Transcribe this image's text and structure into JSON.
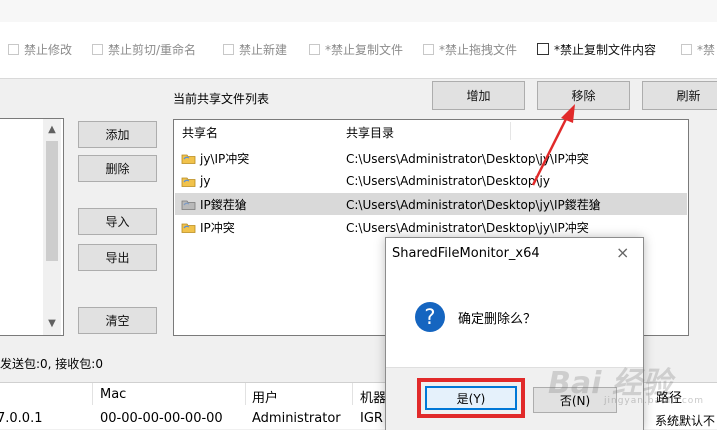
{
  "options": [
    {
      "label": "禁止修改",
      "checked": false,
      "strong": false
    },
    {
      "label": "禁止剪切/重命名",
      "checked": false,
      "strong": false
    },
    {
      "label": "禁止新建",
      "checked": false,
      "strong": false
    },
    {
      "label": "*禁止复制文件",
      "checked": false,
      "strong": false
    },
    {
      "label": "*禁止拖拽文件",
      "checked": false,
      "strong": false
    },
    {
      "label": "*禁止复制文件内容",
      "checked": false,
      "strong": true
    },
    {
      "label": "*禁",
      "checked": false,
      "strong": false
    }
  ],
  "share_list": {
    "label": "当前共享文件列表",
    "buttons": {
      "add": "增加",
      "remove": "移除",
      "refresh": "刷新"
    },
    "columns": [
      "共享名",
      "共享目录"
    ],
    "rows": [
      {
        "name": "jy\\IP冲突",
        "path": "C:\\Users\\Administrator\\Desktop\\jy\\IP冲突",
        "selected": false
      },
      {
        "name": "jy",
        "path": "C:\\Users\\Administrator\\Desktop\\jy",
        "selected": false
      },
      {
        "name": "IP鍐茬獊",
        "path": "C:\\Users\\Administrator\\Desktop\\jy\\IP鍐茬獊",
        "selected": true
      },
      {
        "name": "IP冲突",
        "path": "C:\\Users\\Administrator\\Desktop\\jy\\IP冲突",
        "selected": false
      }
    ]
  },
  "side_buttons": {
    "add": "添加",
    "delete": "删除",
    "import": "导入",
    "export": "导出",
    "clear": "清空"
  },
  "status": "发送包:0, 接收包:0",
  "bottom_table": {
    "headers": [
      "Mac",
      "用户",
      "机器",
      "路径"
    ],
    "row": {
      "ip": "7.0.0.1",
      "mac": "00-00-00-00-00-00",
      "user": "Administrator",
      "machine": "IGR",
      "path": "系统默认不"
    }
  },
  "dialog": {
    "title": "SharedFileMonitor_x64",
    "close": "×",
    "message": "确定删除么？",
    "yes": "是(Y)",
    "no": "否(N)",
    "icon": "question-icon"
  },
  "watermark": {
    "text": "Bai 经验",
    "sub": "jingyan.baidu.com"
  },
  "colors": {
    "highlight_box": "#e12a2a",
    "arrow": "#e12a2a",
    "question_icon": "#1565c0",
    "selected_row": "#d9d9d9"
  }
}
